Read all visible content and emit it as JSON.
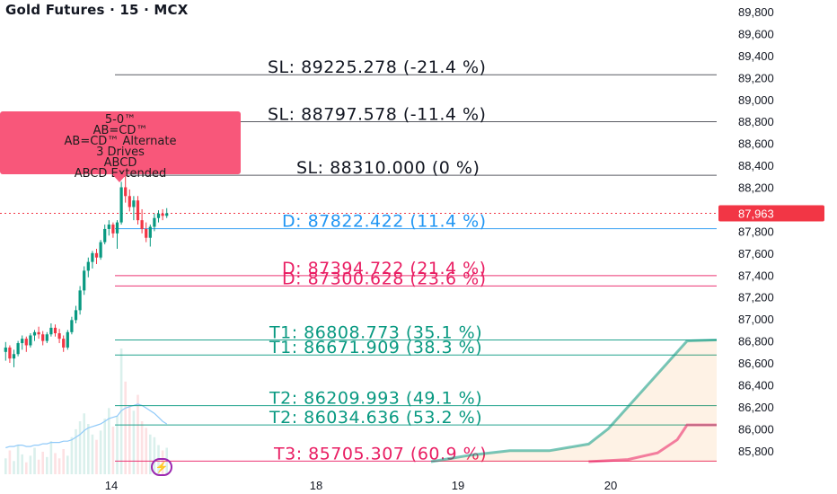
{
  "header": {
    "title": "Gold Futures · 15 · MCX"
  },
  "tooltip": {
    "lines": [
      "5-0™",
      "AB=CD™",
      "AB=CD™ Alternate",
      "3 Drives",
      "ABCD",
      "ABCD Extended"
    ]
  },
  "badge": {
    "icon": "lightning-bolt-icon"
  },
  "colors": {
    "sl": "#131722",
    "d_blue": "#2196f3",
    "d_red": "#e91e63",
    "target": "#089981",
    "price_badge": "#f23645",
    "up": "#089981",
    "down": "#f23645",
    "tooltip_bg": "#f8577a"
  },
  "chart_data": {
    "type": "line",
    "title": "Gold Futures · 15 · MCX",
    "y_axis": {
      "min": 85700,
      "max": 89800,
      "position": "right",
      "ticks": [
        "89,800",
        "89,600",
        "89,400",
        "89,200",
        "89,000",
        "88,800",
        "88,600",
        "88,400",
        "88,200",
        "88,000",
        "87,800",
        "87,600",
        "87,400",
        "87,200",
        "87,000",
        "86,800",
        "86,600",
        "86,400",
        "86,200",
        "86,000",
        "85,800"
      ]
    },
    "x_axis": {
      "ticks": [
        "14",
        "18",
        "19",
        "20"
      ]
    },
    "last_price": {
      "label": "87,963",
      "value": 87963
    },
    "levels": [
      {
        "label": "SL: 89225.278 (-21.4 %)",
        "value": 89225.278,
        "kind": "sl"
      },
      {
        "label": "SL: 88797.578 (-11.4 %)",
        "value": 88797.578,
        "kind": "sl"
      },
      {
        "label": "SL: 88310.000 (0 %)",
        "value": 88310.0,
        "kind": "sl"
      },
      {
        "label": "D: 87822.422 (11.4 %)",
        "value": 87822.422,
        "kind": "d_blue"
      },
      {
        "label": "D: 87394.722 (21.4 %)",
        "value": 87394.722,
        "kind": "d_red"
      },
      {
        "label": "D: 87300.628 (23.6 %)",
        "value": 87300.628,
        "kind": "d_red"
      },
      {
        "label": "T1: 86808.773 (35.1 %)",
        "value": 86808.773,
        "kind": "target"
      },
      {
        "label": "T1: 86671.909 (38.3 %)",
        "value": 86671.909,
        "kind": "target"
      },
      {
        "label": "T2: 86209.993 (49.1 %)",
        "value": 86209.993,
        "kind": "target"
      },
      {
        "label": "T2: 86034.636 (53.2 %)",
        "value": 86034.636,
        "kind": "target"
      },
      {
        "label": "T3: 85705.307 (60.9 %)",
        "value": 85705.307,
        "kind": "d_red"
      }
    ],
    "candles": [
      [
        86700,
        86790,
        86620,
        86740
      ],
      [
        86740,
        86760,
        86600,
        86640
      ],
      [
        86640,
        86720,
        86560,
        86680
      ],
      [
        86680,
        86800,
        86660,
        86780
      ],
      [
        86780,
        86850,
        86720,
        86820
      ],
      [
        86820,
        86840,
        86700,
        86760
      ],
      [
        86760,
        86870,
        86740,
        86850
      ],
      [
        86850,
        86900,
        86800,
        86880
      ],
      [
        86880,
        86930,
        86820,
        86860
      ],
      [
        86860,
        86890,
        86760,
        86800
      ],
      [
        86800,
        86880,
        86780,
        86860
      ],
      [
        86860,
        86960,
        86840,
        86920
      ],
      [
        86920,
        86950,
        86840,
        86870
      ],
      [
        86870,
        86910,
        86780,
        86820
      ],
      [
        86820,
        86850,
        86700,
        86740
      ],
      [
        86740,
        86900,
        86720,
        86880
      ],
      [
        86880,
        87020,
        86860,
        86990
      ],
      [
        86990,
        87120,
        86960,
        87080
      ],
      [
        87080,
        87300,
        87040,
        87260
      ],
      [
        87260,
        87480,
        87220,
        87440
      ],
      [
        87440,
        87560,
        87380,
        87520
      ],
      [
        87520,
        87620,
        87460,
        87600
      ],
      [
        87600,
        87640,
        87500,
        87560
      ],
      [
        87560,
        87720,
        87540,
        87700
      ],
      [
        87700,
        87860,
        87680,
        87820
      ],
      [
        87820,
        87900,
        87760,
        87860
      ],
      [
        87860,
        87880,
        87740,
        87780
      ],
      [
        87780,
        87900,
        87640,
        87880
      ],
      [
        87880,
        88250,
        87860,
        88200
      ],
      [
        88200,
        88310,
        88060,
        88120
      ],
      [
        88120,
        88180,
        87980,
        88020
      ],
      [
        88020,
        88120,
        87900,
        88080
      ],
      [
        88080,
        88120,
        87860,
        87900
      ],
      [
        87900,
        88000,
        87780,
        87820
      ],
      [
        87820,
        87880,
        87700,
        87740
      ],
      [
        87740,
        87860,
        87660,
        87840
      ],
      [
        87840,
        87960,
        87800,
        87920
      ],
      [
        87920,
        87990,
        87880,
        87960
      ],
      [
        87960,
        88000,
        87900,
        87940
      ],
      [
        87940,
        88010,
        87920,
        87963
      ]
    ],
    "volume": [
      12,
      18,
      10,
      22,
      15,
      9,
      14,
      20,
      11,
      17,
      13,
      25,
      16,
      12,
      19,
      14,
      28,
      34,
      40,
      46,
      38,
      30,
      26,
      33,
      42,
      50,
      36,
      44,
      95,
      70,
      52,
      48,
      60,
      40,
      35,
      30,
      28,
      22,
      18,
      20
    ],
    "volume_ma": [
      20,
      21,
      21,
      22,
      22,
      21,
      21,
      22,
      22,
      23,
      23,
      24,
      24,
      24,
      25,
      25,
      26,
      28,
      30,
      33,
      35,
      36,
      37,
      38,
      40,
      42,
      43,
      44,
      48,
      50,
      51,
      52,
      53,
      52,
      50,
      48,
      46,
      43,
      40,
      38
    ],
    "step_series": [
      {
        "name": "",
        "kind": "target",
        "points": [
          [
            19,
            85700
          ],
          [
            19.4,
            85760
          ],
          [
            19.8,
            85800
          ],
          [
            20.2,
            85800
          ],
          [
            20.6,
            85860
          ],
          [
            20.8,
            86000
          ],
          [
            21.0,
            86200
          ],
          [
            21.2,
            86400
          ],
          [
            21.4,
            86600
          ],
          [
            21.6,
            86800
          ],
          [
            21.9,
            86808.773
          ]
        ]
      },
      {
        "name": "",
        "kind": "d_red",
        "points": [
          [
            20.6,
            85700
          ],
          [
            21.0,
            85720
          ],
          [
            21.3,
            85780
          ],
          [
            21.5,
            85900
          ],
          [
            21.6,
            86034.636
          ],
          [
            21.9,
            86034.636
          ]
        ]
      }
    ]
  }
}
